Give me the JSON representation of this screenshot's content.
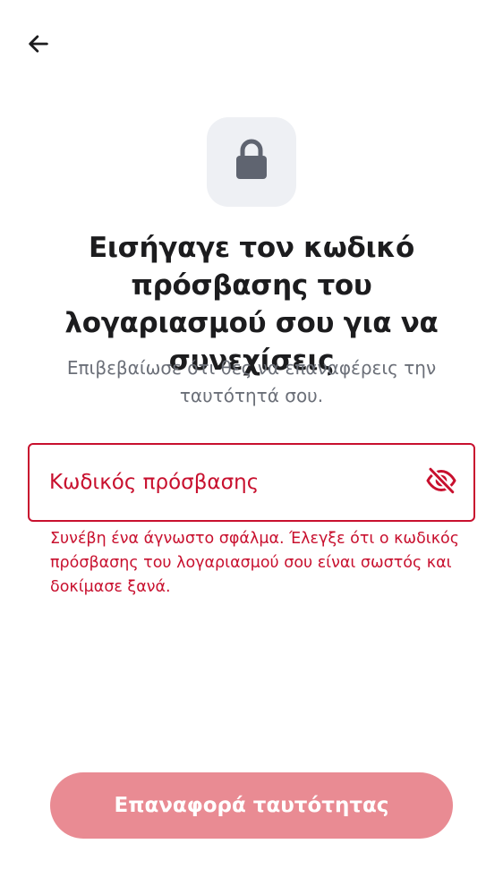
{
  "nav": {
    "back_icon": "arrow-left-icon"
  },
  "header": {
    "lock_icon": "lock-icon",
    "title": "Εισήγαγε τον κωδικό πρόσβασης του λογαριασμού σου για να συνεχίσεις",
    "subtitle": "Επιβεβαίωσε ότι θες να επαναφέρεις την ταυτότητά σου."
  },
  "password": {
    "value": "",
    "placeholder": "Κωδικός πρόσβασης",
    "visibility_icon": "eye-off-icon",
    "error": "Συνέβη ένα άγνωστο σφάλμα. Έλεγξε ότι ο κωδικός πρόσβασης του λογαριασμού σου είναι σωστός και δοκίμασε ξανά."
  },
  "footer": {
    "submit_label": "Επαναφορά ταυτότητας"
  },
  "colors": {
    "error": "#c8102e",
    "button_disabled": "#e98b93",
    "icon_tile": "#eef0f4",
    "icon": "#5f6470",
    "text": "#1c1c1e",
    "muted": "#6b6f78"
  }
}
